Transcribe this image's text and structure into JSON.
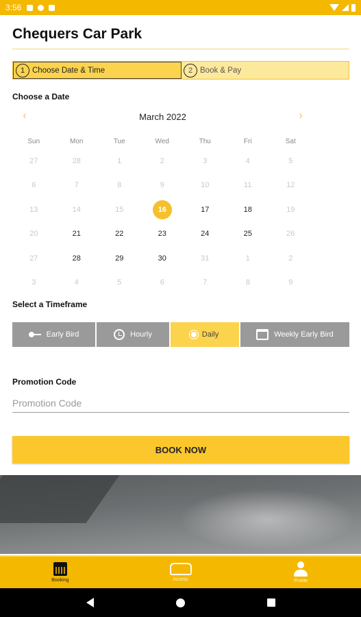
{
  "status_bar": {
    "time": "3:56"
  },
  "header": {
    "title": "Chequers Car Park"
  },
  "stepper": [
    {
      "num": "1",
      "label": "Choose Date & Time"
    },
    {
      "num": "2",
      "label": "Book & Pay"
    }
  ],
  "calendar": {
    "section_label": "Choose a Date",
    "prev": "‹",
    "next": "›",
    "month": "March 2022",
    "weekdays": [
      "Sun",
      "Mon",
      "Tue",
      "Wed",
      "Thu",
      "Fri",
      "Sat"
    ],
    "weeks": [
      [
        "27",
        "28",
        "1",
        "2",
        "3",
        "4",
        "5"
      ],
      [
        "6",
        "7",
        "8",
        "9",
        "10",
        "11",
        "12"
      ],
      [
        "13",
        "14",
        "15",
        "16",
        "17",
        "18",
        "19"
      ],
      [
        "20",
        "21",
        "22",
        "23",
        "24",
        "25",
        "26"
      ],
      [
        "27",
        "28",
        "29",
        "30",
        "31",
        "1",
        "2"
      ],
      [
        "3",
        "4",
        "5",
        "6",
        "7",
        "8",
        "9"
      ]
    ],
    "selected_day": "16"
  },
  "timeframe": {
    "section_label": "Select a Timeframe",
    "options": [
      {
        "label": "Early Bird",
        "icon": "key-icon"
      },
      {
        "label": "Hourly",
        "icon": "clock-icon"
      },
      {
        "label": "Daily",
        "icon": "sun-icon"
      },
      {
        "label": "Weekly Early Bird",
        "icon": "calendar-icon"
      }
    ],
    "selected": "Daily"
  },
  "promo": {
    "label": "Promotion Code",
    "placeholder": "Promotion Code",
    "value": ""
  },
  "book_button": {
    "label": "BOOK NOW"
  },
  "bottom_nav": [
    {
      "label": "Booking",
      "icon": "calendar-icon"
    },
    {
      "label": "Access",
      "icon": "car-icon"
    },
    {
      "label": "Profile",
      "icon": "person-icon"
    }
  ],
  "colors": {
    "accent": "#f5b800",
    "button": "#fbc72c",
    "inactive": "#9a9a9a"
  }
}
